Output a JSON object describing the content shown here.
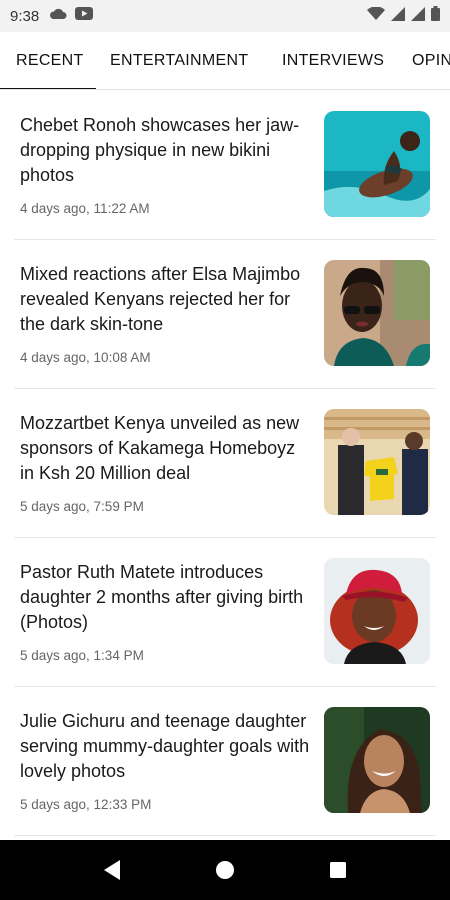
{
  "status_bar": {
    "time": "9:38",
    "left_icons": [
      "cloud-icon",
      "youtube-icon"
    ],
    "right_icons": [
      "wifi-icon",
      "signal-icon",
      "signal-icon",
      "battery-icon"
    ]
  },
  "tabs": [
    {
      "label": "RECENT",
      "active": true
    },
    {
      "label": "ENTERTAINMENT",
      "active": false
    },
    {
      "label": "INTERVIEWS",
      "active": false
    },
    {
      "label": "OPINION",
      "active": false
    }
  ],
  "articles": [
    {
      "title": "Chebet Ronoh showcases her jaw-dropping physique in new bikini photos",
      "time": "4 days ago, 11:22 AM",
      "image": "woman-pool-photo"
    },
    {
      "title": "Mixed reactions after Elsa Majimbo revealed Kenyans rejected her for the dark skin-tone",
      "time": "4 days ago, 10:08 AM",
      "image": "woman-sunglasses-photo"
    },
    {
      "title": "Mozzartbet Kenya unveiled as new sponsors of Kakamega Homeboyz in Ksh 20 Million deal",
      "time": "5 days ago, 7:59 PM",
      "image": "jersey-presentation-photo"
    },
    {
      "title": "Pastor Ruth Matete introduces daughter 2 months after giving birth (Photos)",
      "time": "5 days ago, 1:34 PM",
      "image": "woman-red-cap-photo"
    },
    {
      "title": "Julie Gichuru and teenage daughter serving mummy-daughter goals with lovely photos",
      "time": "5 days ago, 12:33 PM",
      "image": "woman-smiling-photo"
    }
  ],
  "nav_bar": {
    "buttons": [
      "back-icon",
      "home-icon",
      "recents-icon"
    ]
  },
  "colors": {
    "accent": "#111111",
    "status_bar_bg": "#f2f2f2",
    "nav_bar_bg": "#000000",
    "timestamp": "#666666"
  }
}
